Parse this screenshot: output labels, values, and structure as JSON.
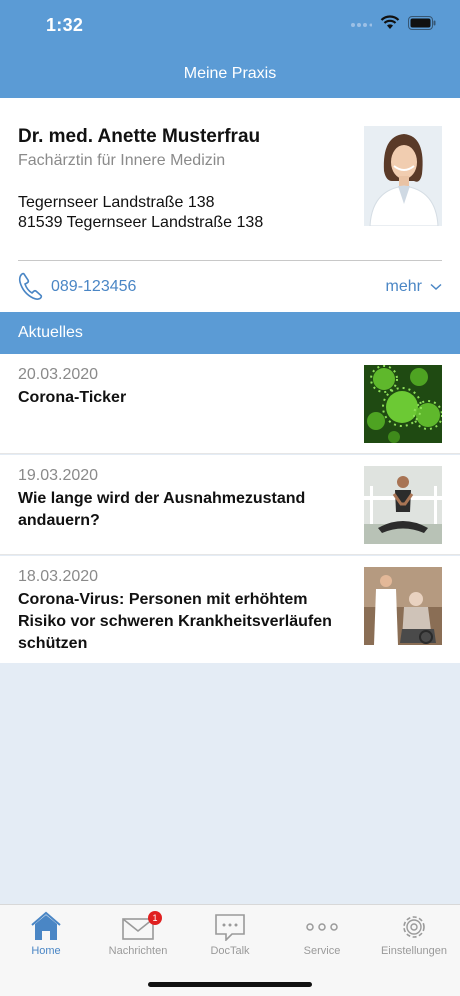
{
  "status_bar": {
    "time": "1:32"
  },
  "header": {
    "title": "Meine Praxis"
  },
  "doctor": {
    "name": "Dr. med. Anette Musterfrau",
    "specialty": "Fachärztin für Innere Medizin",
    "address_line1": "Tegernseer Landstraße 138",
    "address_line2": "81539 Tegernseer Landstraße 138",
    "phone": "089-123456",
    "more_label": "mehr"
  },
  "news_section": {
    "title": "Aktuelles",
    "items": [
      {
        "date": "20.03.2020",
        "title": "Corona-Ticker",
        "thumb_icon": "virus-image"
      },
      {
        "date": "19.03.2020",
        "title": "Wie lange wird der Ausnahmezustand andauern?",
        "thumb_icon": "yoga-image"
      },
      {
        "date": "18.03.2020",
        "title": "Corona-Virus: Personen mit erhöhtem Risiko vor schweren Krankheitsverläufen schützen",
        "thumb_icon": "doctor-patient-image"
      }
    ]
  },
  "tabbar": {
    "tabs": [
      {
        "label": "Home",
        "icon": "home-icon",
        "active": true
      },
      {
        "label": "Nachrichten",
        "icon": "mail-icon",
        "badge": "1"
      },
      {
        "label": "DocTalk",
        "icon": "chat-icon"
      },
      {
        "label": "Service",
        "icon": "dots-icon"
      },
      {
        "label": "Einstellungen",
        "icon": "gear-icon"
      }
    ]
  },
  "colors": {
    "accent": "#5b9bd5",
    "link": "#4a86c5",
    "background": "#e4ecf5",
    "badge": "#e02020"
  }
}
